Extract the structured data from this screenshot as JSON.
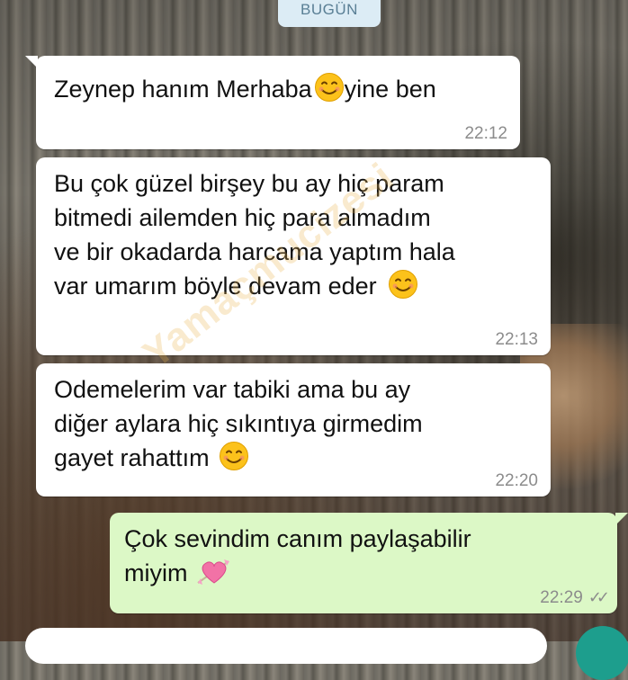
{
  "chat": {
    "date_label": "BUGÜN",
    "watermark": "Yamaçmucizesi",
    "messages": [
      {
        "direction": "in",
        "text": "Zeynep hanım Merhaba",
        "after_emoji": "yine ben",
        "emoji": "smiling-face",
        "time": "22:12"
      },
      {
        "direction": "in",
        "line1": "Bu çok güzel birşey bu ay hiç param",
        "line2": "bitmedi ailemden hiç para almadım",
        "line3": "ve bir okadarda harcama yaptım hala",
        "line4": "var umarım böyle devam eder",
        "emoji": "smiling-face",
        "time": "22:13"
      },
      {
        "direction": "in",
        "line1": "Odemelerim var tabiki ama bu ay",
        "line2": "diğer aylara hiç sıkıntıya girmedim",
        "line3": "gayet rahattım",
        "emoji": "smiling-face",
        "time": "22:20"
      },
      {
        "direction": "out",
        "line1": "Çok sevindim canım paylaşabilir",
        "line2": "miyim",
        "emoji": "heart-with-arrow",
        "time": "22:29",
        "status": "read-double-check"
      }
    ]
  },
  "colors": {
    "incoming_bubble": "#ffffff",
    "outgoing_bubble": "#dcf8c6",
    "date_chip": "#dcecf5",
    "timestamp": "#8c8c8c",
    "send_button": "#1d9e8d"
  }
}
